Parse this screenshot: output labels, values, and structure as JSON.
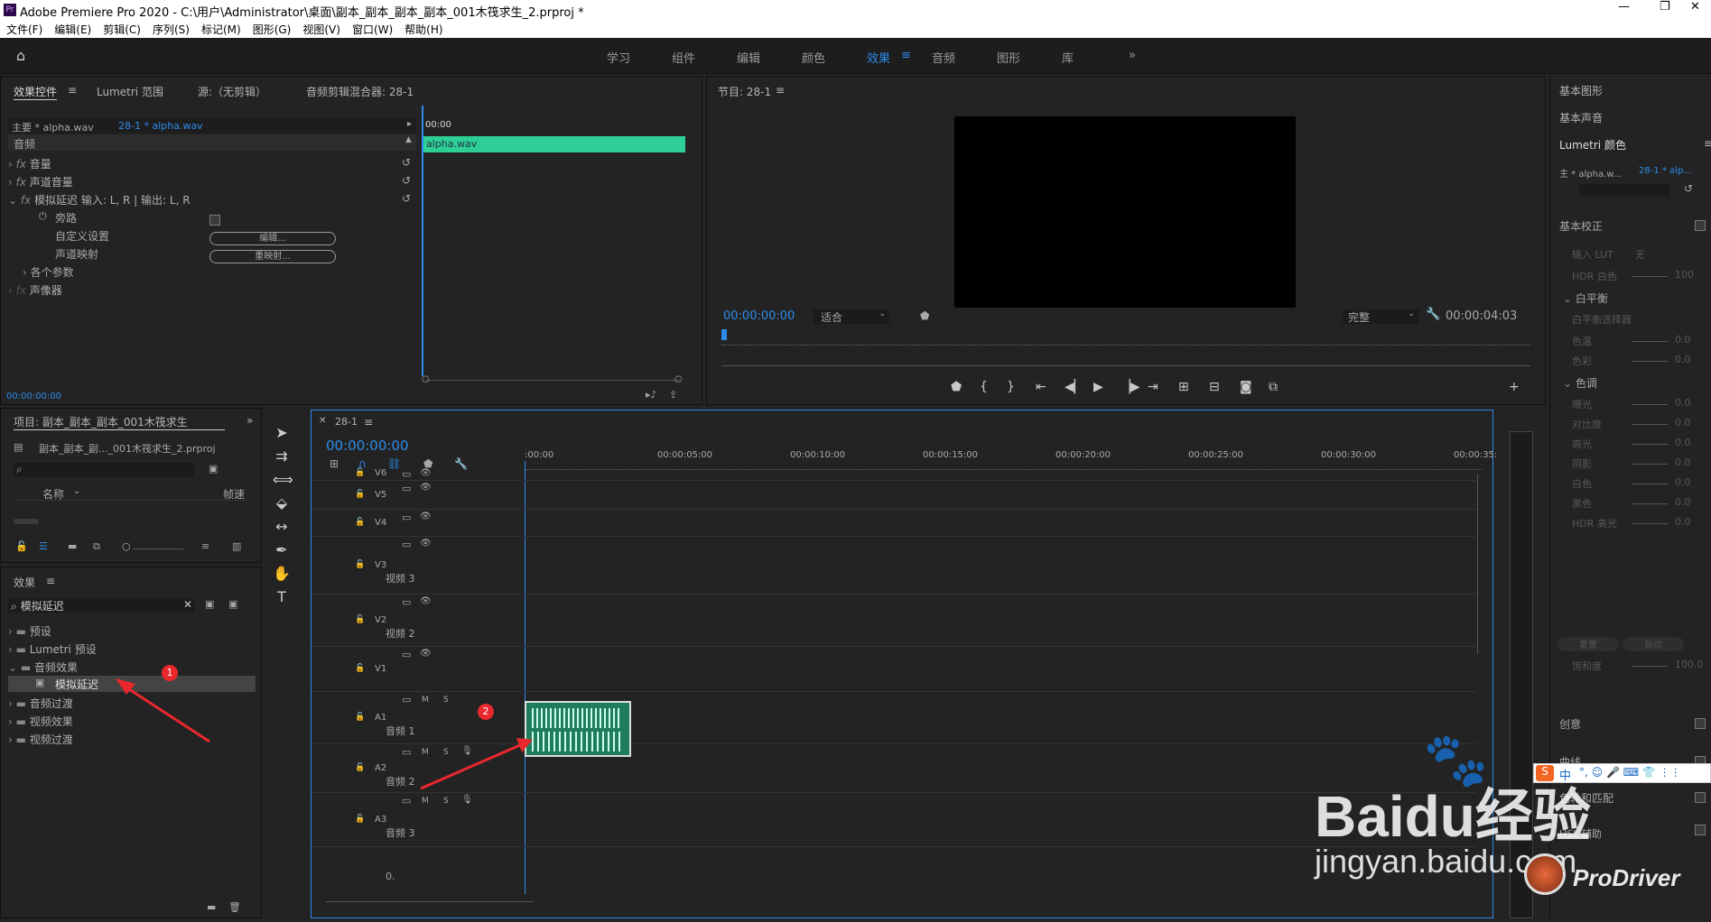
{
  "window": {
    "title": "Adobe Premiere Pro 2020 - C:\\用户\\Administrator\\桌面\\副本_副本_副本_副本_001木筏求生_2.prproj *"
  },
  "menu": [
    "文件(F)",
    "编辑(E)",
    "剪辑(C)",
    "序列(S)",
    "标记(M)",
    "图形(G)",
    "视图(V)",
    "窗口(W)",
    "帮助(H)"
  ],
  "workspaces": [
    "学习",
    "组件",
    "编辑",
    "颜色",
    "效果",
    "音频",
    "图形",
    "库"
  ],
  "effect_controls": {
    "tabs": [
      "效果控件",
      "Lumetri 范围",
      "源:（无剪辑）",
      "音频剪辑混合器: 28-1"
    ],
    "master": "主要 * alpha.wav",
    "clip": "28-1 * alpha.wav",
    "time_ruler": "00:00",
    "clip_bar": "alpha.wav",
    "section": "音频",
    "rows": [
      "音量",
      "声道音量",
      "模拟延迟 输入: L, R | 输出: L, R",
      "旁路",
      "自定义设置",
      "声道映射",
      "各个参数",
      "声像器"
    ],
    "btn_edit": "编辑...",
    "btn_remap": "重映射...",
    "timecode": "00:00:00:00"
  },
  "program": {
    "title": "节目: 28-1",
    "timecode": "00:00:00:00",
    "fit": "适合",
    "quality": "完整",
    "duration": "00:00:04:03"
  },
  "project": {
    "title": "项目: 副本_副本_副本_001木筏求生",
    "file": "副本_副本_副..._001木筏求生_2.prproj",
    "col_name": "名称",
    "col_rate": "帧速"
  },
  "effects": {
    "title": "效果",
    "search": "模拟延迟",
    "items": [
      "预设",
      "Lumetri 预设",
      "音频效果",
      "模拟延迟",
      "音频过渡",
      "视频效果",
      "视频过渡"
    ]
  },
  "timeline": {
    "tab": "28-1",
    "timecode": "00:00:00:00",
    "ruler": [
      ":00:00",
      "00:00:05:00",
      "00:00:10:00",
      "00:00:15:00",
      "00:00:20:00",
      "00:00:25:00",
      "00:00:30:00",
      "00:00:35:"
    ],
    "tracks": [
      "V6",
      "V5",
      "V4",
      "V3",
      "V2",
      "V1",
      "A1",
      "A2",
      "A3"
    ],
    "track_names": {
      "V3": "视频 3",
      "V2": "视频 2",
      "A1": "音频 1",
      "A2": "音频 2",
      "A3": "音频 3"
    },
    "m": "M",
    "s": "S",
    "master": "0."
  },
  "right": {
    "tabs": [
      "基本图形",
      "基本声音",
      "Lumetri 颜色"
    ],
    "master": "主 * alpha.w...",
    "clip": "28-1 * alp...",
    "sections": [
      "基本校正",
      "创意",
      "曲线",
      "色轮和匹配",
      "HSL 辅助"
    ],
    "input_lut": "输入 LUT",
    "lut_value": "无",
    "hdr_white": "HDR 白色",
    "hdr_val": "100",
    "wb": "白平衡",
    "wb_sel": "白平衡选择器",
    "temp": "色温",
    "tint": "色彩",
    "tone": "色调",
    "tone_rows": [
      "曝光",
      "对比度",
      "高光",
      "阴影",
      "白色",
      "黑色",
      "HDR 高光"
    ],
    "zero": "0.0",
    "reset": "重置",
    "auto": "自动",
    "sat": "饱和度",
    "sat_val": "100.0"
  },
  "annotations": {
    "badge1": "1",
    "badge2": "2"
  },
  "watermark": {
    "brand": "Bai",
    "brand2": "du",
    "brand3": "经验",
    "url": "jingyan.baidu.com",
    "pd": "ProDriver"
  },
  "ime": {
    "label": "中"
  }
}
